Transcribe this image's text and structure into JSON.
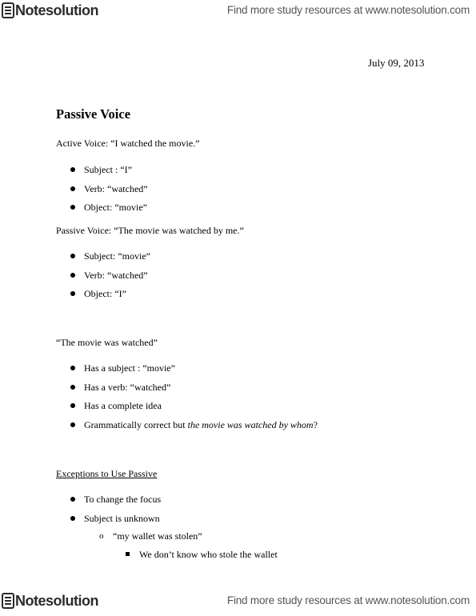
{
  "header": {
    "logo_text": "Notesolution",
    "promo_text": "Find more study resources at www.notesolution.com"
  },
  "footer": {
    "logo_text": "Notesolution",
    "promo_text": "Find more study resources at www.notesolution.com"
  },
  "document": {
    "date": "July 09, 2013",
    "title": "Passive Voice",
    "active_intro": "Active Voice: “I watched the movie.”",
    "active_items": [
      "Subject : “I”",
      "Verb: “watched”",
      "Object: “movie”"
    ],
    "passive_intro": "Passive Voice: “The movie was watched by me.”",
    "passive_items": [
      "Subject: “movie”",
      "Verb: “watched”",
      "Object: “I”"
    ],
    "fragment_intro": "“The movie was watched”",
    "fragment_items": [
      "Has a subject : “movie”",
      "Has a verb: “watched”",
      "Has a complete idea"
    ],
    "fragment_last_item_plain": "Grammatically correct but ",
    "fragment_last_item_italic": "the movie was watched by whom",
    "fragment_last_item_end": "?",
    "exceptions_heading": "Exceptions to Use Passive",
    "exceptions_items": [
      "To change the focus",
      "Subject is unknown"
    ],
    "exceptions_subitem": "“my wallet was stolen”",
    "exceptions_subsubitem": "We don’t know who stole the wallet"
  }
}
